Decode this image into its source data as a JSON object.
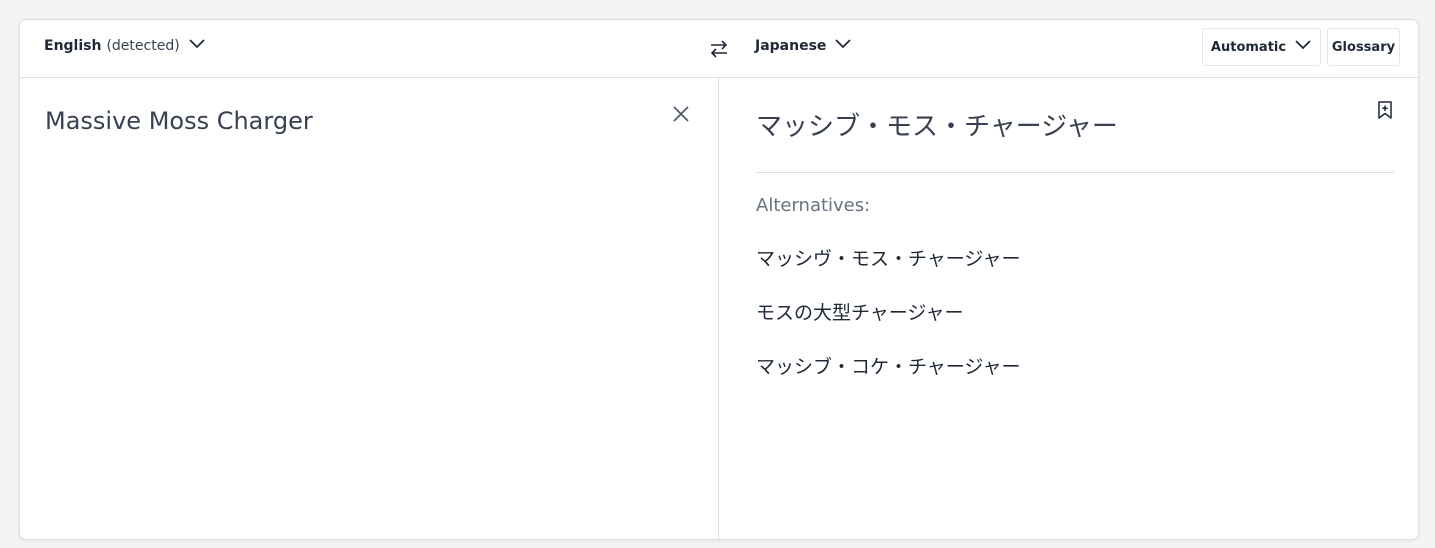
{
  "source": {
    "language": "English",
    "detected_label": "(detected)",
    "text": "Massive Moss Charger"
  },
  "target": {
    "language": "Japanese",
    "text": "マッシブ・モス・チャージャー",
    "alternatives_label": "Alternatives:",
    "alternatives": [
      "マッシヴ・モス・チャージャー",
      "モスの大型チャージャー",
      "マッシブ・コケ・チャージャー"
    ]
  },
  "toolbar": {
    "formality_label": "Automatic",
    "glossary_label": "Glossary"
  },
  "icons": {
    "swap": "swap-arrows-icon",
    "clear": "close-icon",
    "chevron": "chevron-down-icon",
    "bookmark": "bookmark-add-icon"
  },
  "colors": {
    "text": "#1f2937",
    "muted": "#6b7280",
    "border": "#dcdfe3",
    "background": "#f3f4f6"
  }
}
